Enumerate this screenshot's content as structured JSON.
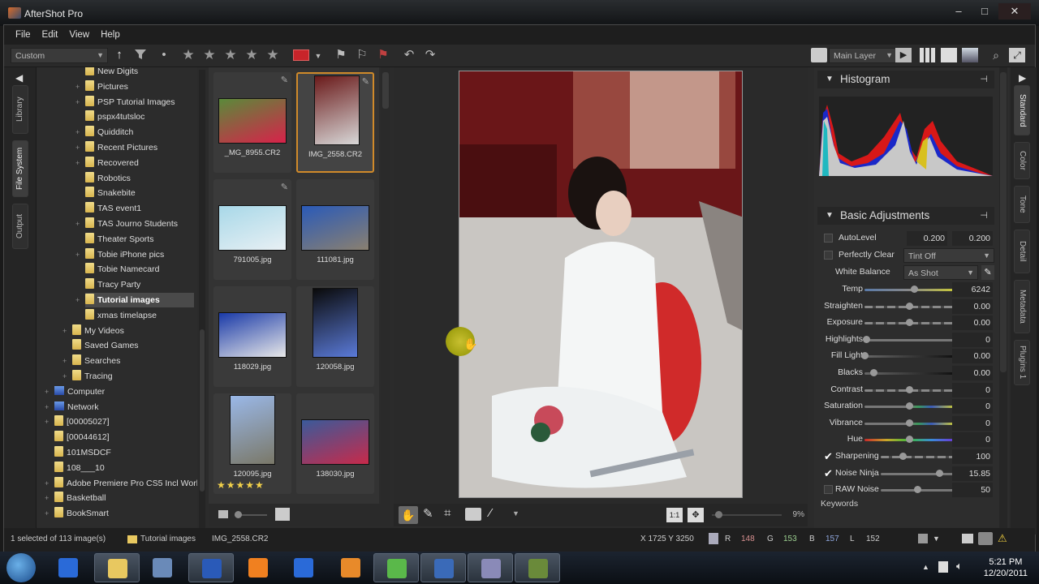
{
  "window": {
    "title": "AfterShot Pro",
    "controls": {
      "minimize": "–",
      "maximize": "□",
      "close": "✕"
    }
  },
  "menu": [
    "File",
    "Edit",
    "View",
    "Help"
  ],
  "toolbar": {
    "preset": "Custom",
    "sort_icon": "↑",
    "filter_icon": "filter-icon",
    "rating_dot": "•",
    "rating_stars": 5,
    "star_glyph": "★",
    "color_label": "#c8242a",
    "layer_select": "Main Layer"
  },
  "left_tabs": [
    "Library",
    "File System",
    "Output"
  ],
  "left_active_tab": "File System",
  "tree": [
    {
      "label": "New Digits",
      "level": 2,
      "expand": false
    },
    {
      "label": "Pictures",
      "level": 2,
      "expand": true
    },
    {
      "label": "PSP Tutorial Images",
      "level": 2,
      "expand": true
    },
    {
      "label": "pspx4tutsloc",
      "level": 2,
      "expand": false
    },
    {
      "label": "Quidditch",
      "level": 2,
      "expand": true
    },
    {
      "label": "Recent Pictures",
      "level": 2,
      "expand": true
    },
    {
      "label": "Recovered",
      "level": 2,
      "expand": true
    },
    {
      "label": "Robotics",
      "level": 2,
      "expand": false
    },
    {
      "label": "Snakebite",
      "level": 2,
      "expand": false
    },
    {
      "label": "TAS event1",
      "level": 2,
      "expand": false
    },
    {
      "label": "TAS Journo Students",
      "level": 2,
      "expand": true
    },
    {
      "label": "Theater Sports",
      "level": 2,
      "expand": false
    },
    {
      "label": "Tobie iPhone pics",
      "level": 2,
      "expand": true
    },
    {
      "label": "Tobie Namecard",
      "level": 2,
      "expand": false
    },
    {
      "label": "Tracy Party",
      "level": 2,
      "expand": false
    },
    {
      "label": "Tutorial images",
      "level": 2,
      "expand": true,
      "selected": true
    },
    {
      "label": "xmas timelapse",
      "level": 2,
      "expand": false
    },
    {
      "label": "My Videos",
      "level": 1,
      "expand": true
    },
    {
      "label": "Saved Games",
      "level": 1,
      "expand": false
    },
    {
      "label": "Searches",
      "level": 1,
      "expand": true
    },
    {
      "label": "Tracing",
      "level": 1,
      "expand": true
    },
    {
      "label": "Computer",
      "level": 0,
      "expand": true,
      "icon": "computer"
    },
    {
      "label": "Network",
      "level": 0,
      "expand": true,
      "icon": "network"
    },
    {
      "label": "[00005027]",
      "level": 0,
      "expand": true
    },
    {
      "label": "[00044612]",
      "level": 0,
      "expand": false
    },
    {
      "label": "101MSDCF",
      "level": 0,
      "expand": false
    },
    {
      "label": "108___10",
      "level": 0,
      "expand": false
    },
    {
      "label": "Adobe Premiere Pro CS5 Incl Worki",
      "level": 0,
      "expand": true
    },
    {
      "label": "Basketball",
      "level": 0,
      "expand": true
    },
    {
      "label": "BookSmart",
      "level": 0,
      "expand": true
    }
  ],
  "thumbnails": [
    {
      "name": "_MG_8955.CR2",
      "colors": [
        "#5a8a3a",
        "#d8224a"
      ],
      "orient": "land",
      "edited": true
    },
    {
      "name": "IMG_2558.CR2",
      "colors": [
        "#6a1a1a",
        "#d8d8d8"
      ],
      "orient": "port",
      "edited": true,
      "selected": true
    },
    {
      "name": "791005.jpg",
      "colors": [
        "#a8d8e8",
        "#e8f0f4"
      ],
      "orient": "land",
      "edited": true
    },
    {
      "name": "111081.jpg",
      "colors": [
        "#2a5ab8",
        "#8a8070"
      ],
      "orient": "land",
      "edited": false
    },
    {
      "name": "118029.jpg",
      "colors": [
        "#1a3aa8",
        "#e8e8e8"
      ],
      "orient": "land",
      "edited": false
    },
    {
      "name": "120058.jpg",
      "colors": [
        "#0a0a0a",
        "#5a7ad8"
      ],
      "orient": "port",
      "edited": false
    },
    {
      "name": "120095.jpg",
      "colors": [
        "#9ab8e8",
        "#7a7868"
      ],
      "orient": "port",
      "edited": false,
      "stars": 5
    },
    {
      "name": "138030.jpg",
      "colors": [
        "#3a5a9a",
        "#c82a4a"
      ],
      "orient": "land",
      "edited": false
    }
  ],
  "viewer": {
    "zoom": "9%",
    "zoom_fraction": 0.09,
    "tools": [
      "hand-tool",
      "eyedropper-tool",
      "crop-tool",
      "redeye-tool",
      "brush-tool"
    ],
    "fit_1to1": "1:1"
  },
  "right_tabs": [
    "Standard",
    "Color",
    "Tone",
    "Detail",
    "Metadata",
    "Plugins 1"
  ],
  "right_active_tab": "Standard",
  "histogram": {
    "title": "Histogram"
  },
  "basic": {
    "title": "Basic Adjustments",
    "autolevel": {
      "label": "AutoLevel",
      "checked": false,
      "v1": "0.200",
      "v2": "0.200"
    },
    "perfectly_clear": {
      "label": "Perfectly Clear",
      "checked": false,
      "value": "Tint Off"
    },
    "white_balance": {
      "label": "White Balance",
      "value": "As Shot"
    },
    "sliders": [
      {
        "label": "Temp",
        "value": "6242",
        "pos": 0.55,
        "kind": "temp"
      },
      {
        "label": "Straighten",
        "value": "0.00",
        "pos": 0.5,
        "kind": "dash"
      },
      {
        "label": "Exposure",
        "value": "0.00",
        "pos": 0.5,
        "kind": "dash"
      },
      {
        "label": "Highlights",
        "value": "0",
        "pos": 0.02,
        "kind": "plain"
      },
      {
        "label": "Fill Light",
        "value": "0.00",
        "pos": 0.0,
        "kind": "dark"
      },
      {
        "label": "Blacks",
        "value": "0.00",
        "pos": 0.1,
        "kind": "dark"
      },
      {
        "label": "Contrast",
        "value": "0",
        "pos": 0.5,
        "kind": "dash"
      },
      {
        "label": "Saturation",
        "value": "0",
        "pos": 0.5,
        "kind": "color"
      },
      {
        "label": "Vibrance",
        "value": "0",
        "pos": 0.5,
        "kind": "color"
      },
      {
        "label": "Hue",
        "value": "0",
        "pos": 0.5,
        "kind": "hue"
      },
      {
        "label": "Sharpening",
        "value": "100",
        "pos": 0.3,
        "kind": "dash",
        "check": true
      },
      {
        "label": "Noise Ninja",
        "value": "15.85",
        "pos": 0.8,
        "kind": "plain",
        "check": true
      },
      {
        "label": "RAW Noise",
        "value": "50",
        "pos": 0.5,
        "kind": "plain",
        "check": false
      }
    ],
    "keywords_label": "Keywords"
  },
  "status": {
    "selection": "1 selected of 113 image(s)",
    "folder": "Tutorial images",
    "file": "IMG_2558.CR2",
    "coords": "X 1725  Y 3250",
    "r_label": "R",
    "r": "148",
    "g_label": "G",
    "g": "153",
    "b_label": "B",
    "b": "157",
    "l_label": "L",
    "l": "152"
  },
  "taskbar": {
    "apps": [
      "start",
      "internet-explorer",
      "windows-explorer",
      "paint-app",
      "word",
      "vlc",
      "internet-explorer-2",
      "media-player",
      "messenger",
      "camera-app",
      "photo-app",
      "video-camera-app"
    ],
    "time": "5:21 PM",
    "date": "12/20/2011"
  }
}
